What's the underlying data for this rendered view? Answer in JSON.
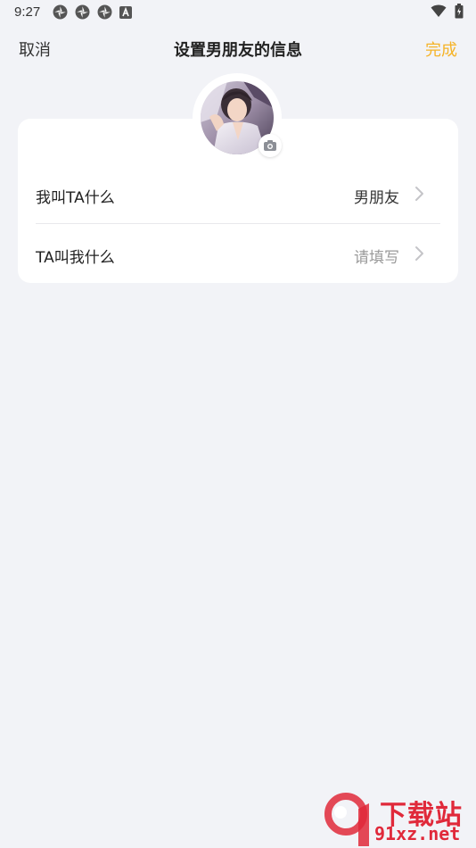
{
  "status_bar": {
    "time": "9:27",
    "icons": [
      "pinwheel-icon",
      "pinwheel-icon",
      "pinwheel-icon",
      "a-badge-icon"
    ],
    "right_icons": [
      "wifi-icon",
      "battery-icon"
    ]
  },
  "header": {
    "cancel_label": "取消",
    "title": "设置男朋友的信息",
    "done_label": "完成",
    "done_color": "#f5b328"
  },
  "avatar": {
    "badge_icon": "camera-icon"
  },
  "rows": [
    {
      "label": "我叫TA什么",
      "value": "男朋友",
      "value_is_placeholder": false,
      "icon": "chevron-right-icon"
    },
    {
      "label": "TA叫我什么",
      "value": "请填写",
      "value_is_placeholder": true,
      "icon": "chevron-right-icon"
    }
  ],
  "watermark": {
    "text": "下载站",
    "url": "91xz.net",
    "color": "#e0293a"
  }
}
